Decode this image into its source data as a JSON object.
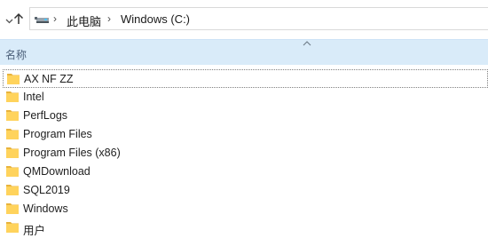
{
  "navigation": {
    "breadcrumb": [
      "此电脑",
      "Windows (C:)"
    ],
    "separator": "›"
  },
  "columns": {
    "name_header": "名称"
  },
  "files": [
    {
      "name": "AX NF ZZ",
      "type": "folder",
      "focused": true
    },
    {
      "name": "Intel",
      "type": "folder"
    },
    {
      "name": "PerfLogs",
      "type": "folder"
    },
    {
      "name": "Program Files",
      "type": "folder"
    },
    {
      "name": "Program Files (x86)",
      "type": "folder"
    },
    {
      "name": "QMDownload",
      "type": "folder"
    },
    {
      "name": "SQL2019",
      "type": "folder"
    },
    {
      "name": "Windows",
      "type": "folder"
    },
    {
      "name": "用户",
      "type": "folder"
    }
  ],
  "icons": {
    "down": "chevron-down-icon",
    "up": "up-arrow-icon",
    "location": "this-pc-icon",
    "folder": "folder-icon",
    "sort": "sort-ascending-icon"
  },
  "colors": {
    "header_bg": "#d9ebf9",
    "folder_fill": "#ffd35c",
    "folder_tab": "#e8b33c"
  }
}
